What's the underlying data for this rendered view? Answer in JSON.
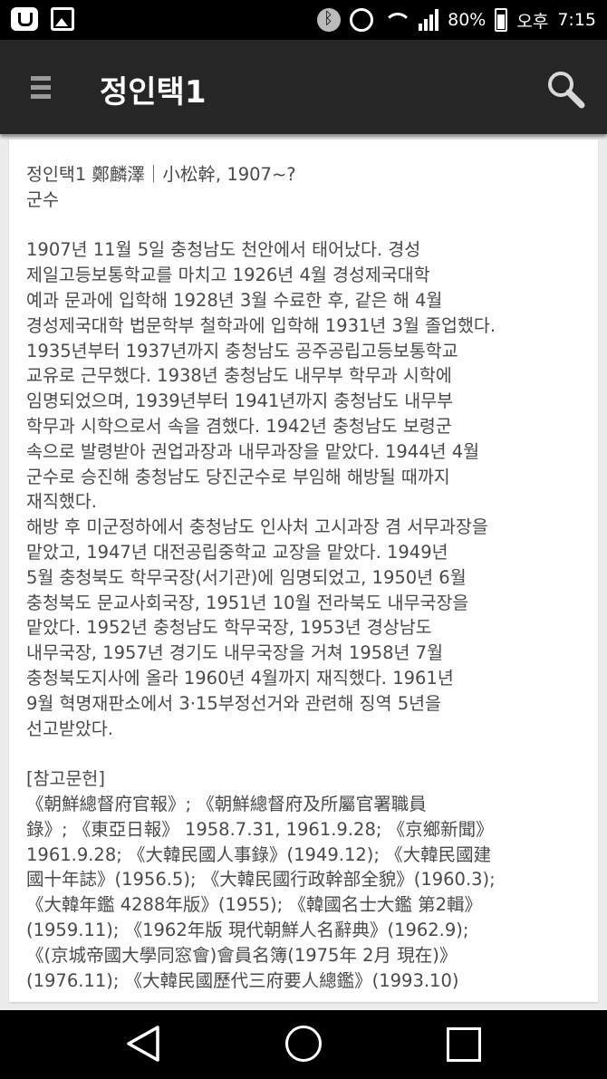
{
  "status_bar": {
    "battery": "80%",
    "ampm": "오후",
    "time": "7:15",
    "icons": [
      "app-notification-icon",
      "image-notification-icon",
      "bluetooth-icon",
      "alarm-icon",
      "wifi-icon",
      "signal-icon",
      "battery-icon"
    ]
  },
  "app_bar": {
    "title": "정인택1",
    "menu_icon": "hamburger-menu-icon",
    "search_icon": "search-icon"
  },
  "article": {
    "header_lines": [
      "정인택1 鄭麟澤｜小松幹, 1907~?",
      "군수"
    ],
    "body_lines": [
      "1907년 11월 5일 충청남도 천안에서 태어났다. 경성",
      "제일고등보통학교를 마치고 1926년 4월 경성제국대학",
      "예과 문과에 입학해 1928년 3월 수료한 후, 같은 해 4월",
      "경성제국대학 법문학부 철학과에 입학해 1931년 3월 졸업했다.",
      "1935년부터 1937년까지 충청남도 공주공립고등보통학교",
      "교유로 근무했다. 1938년 충청남도 내무부 학무과 시학에",
      "임명되었으며, 1939년부터 1941년까지 충청남도 내무부",
      "학무과 시학으로서 속을 겸했다. 1942년 충청남도 보령군",
      "속으로 발령받아 권업과장과 내무과장을 맡았다. 1944년 4월",
      "군수로 승진해 충청남도 당진군수로 부임해 해방될 때까지",
      "재직했다.",
      "해방 후 미군정하에서 충청남도 인사처 고시과장 겸 서무과장을",
      "맡았고, 1947년 대전공립중학교 교장을 맡았다. 1949년",
      "5월 충청북도 학무국장(서기관)에 임명되었고, 1950년 6월",
      "충청북도 문교사회국장, 1951년 10월 전라북도 내무국장을",
      "맡았다. 1952년 충청남도 학무국장, 1953년 경상남도",
      "내무국장, 1957년 경기도 내무국장을 거쳐 1958년 7월",
      "충청북도지사에 올라 1960년 4월까지 재직했다. 1961년",
      "9월 혁명재판소에서 3·15부정선거와 관련해 징역 5년을",
      "선고받았다."
    ],
    "references_heading": "[참고문헌]",
    "reference_lines": [
      "《朝鮮總督府官報》; 《朝鮮總督府及所屬官署職員",
      "錄》; 《東亞日報》 1958.7.31, 1961.9.28; 《京鄉新聞》",
      "1961.9.28; 《大韓民國人事錄》(1949.12); 《大韓民國建",
      "國十年誌》(1956.5); 《大韓民國行政幹部全貌》(1960.3);",
      "《大韓年鑑 4288年版》(1955); 《韓國名士大鑑 第2輯》",
      "(1959.11); 《1962年版 現代朝鮮人名辭典》(1962.9);",
      "《(京城帝國大學同窓會)會員名簿(1975年 2月 現在)》",
      "(1976.11); 《大韓民國歷代三府要人總鑑》(1993.10)"
    ]
  },
  "nav_bar": {
    "icons": [
      "back-icon",
      "home-icon",
      "recents-icon"
    ]
  }
}
